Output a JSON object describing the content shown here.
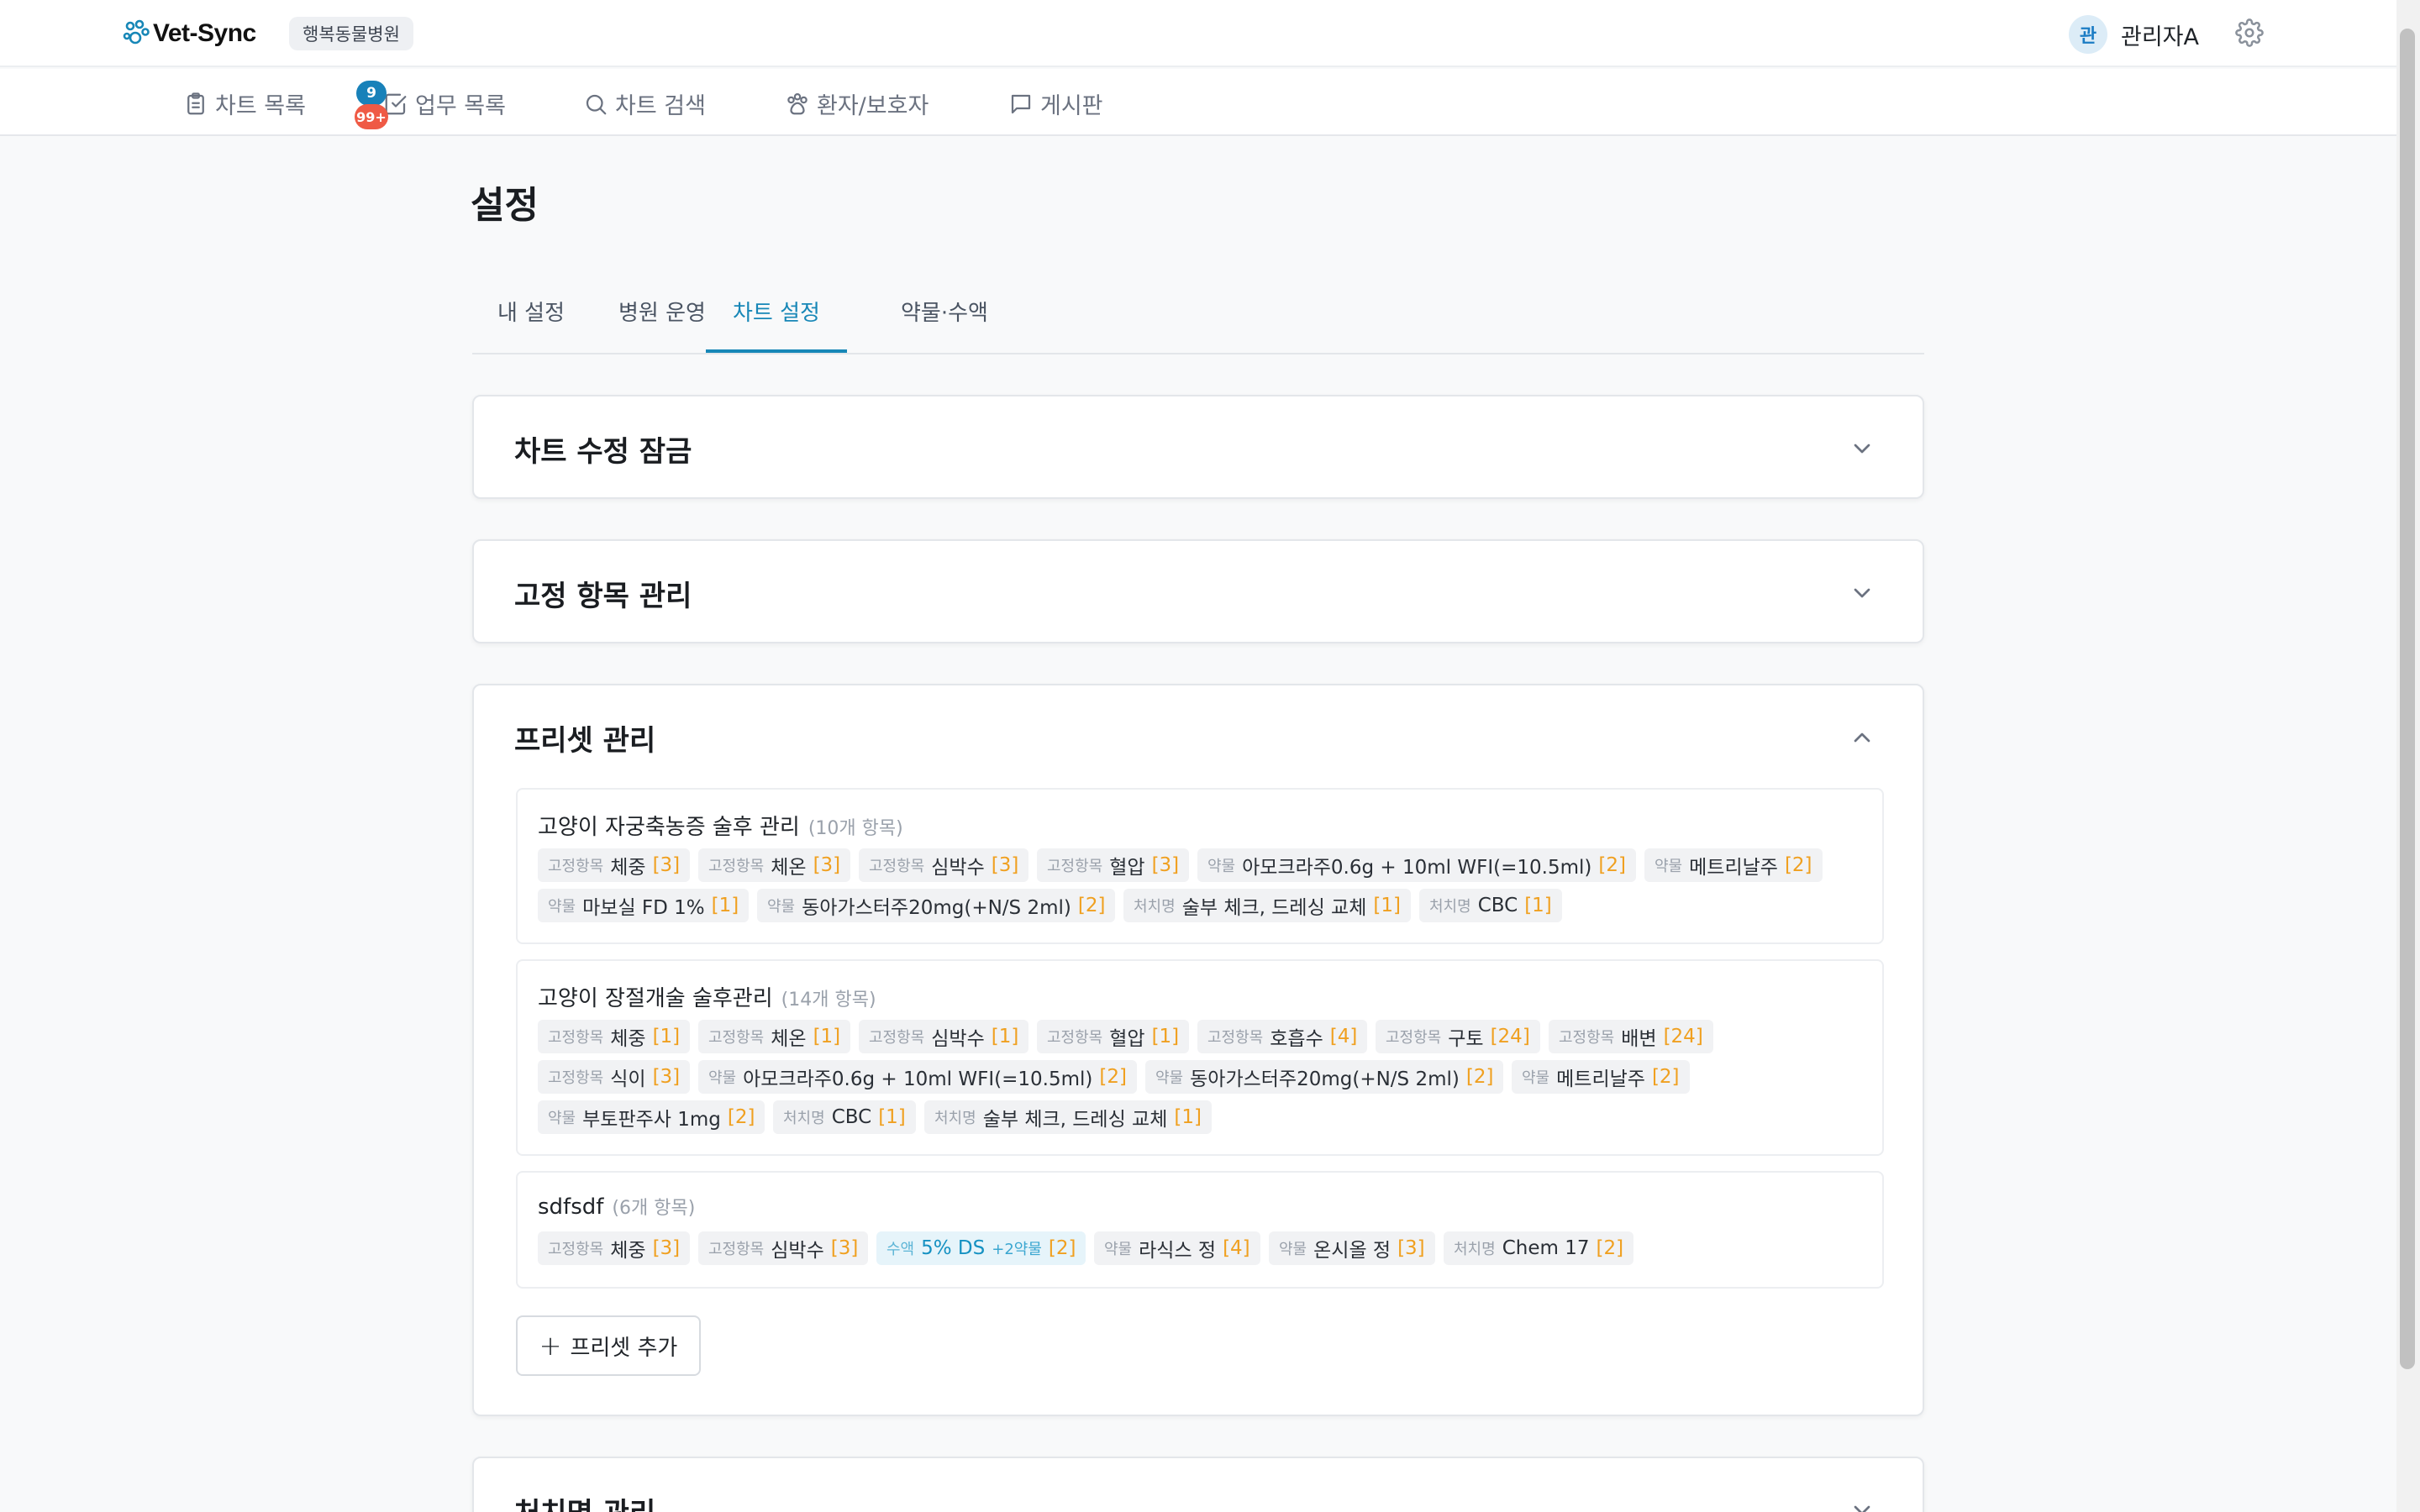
{
  "header": {
    "app_name": "Vet-Sync",
    "hospital": "행복동물병원",
    "avatar_initial": "관",
    "user_name": "관리자A"
  },
  "nav": {
    "items": [
      {
        "label": "차트 목록",
        "icon": "clipboard-icon"
      },
      {
        "label": "업무 목록",
        "icon": "checkbox-icon"
      },
      {
        "label": "차트 검색",
        "icon": "search-icon"
      },
      {
        "label": "환자/보호자",
        "icon": "paw-icon"
      },
      {
        "label": "게시판",
        "icon": "message-icon"
      }
    ],
    "badge_top": "9",
    "badge_bottom": "99+"
  },
  "page": {
    "title": "설정",
    "tabs": [
      "내 설정",
      "병원 운영",
      "차트 설정",
      "약물·수액"
    ],
    "active_tab": "차트 설정"
  },
  "sections": {
    "lock": "차트 수정 잠금",
    "fixed": "고정 항목 관리",
    "preset": "프리셋 관리",
    "treatment": "처치명 관리"
  },
  "presets": [
    {
      "name": "고양이 자궁축농증 술후 관리",
      "count": "(10개 항목)",
      "chips": [
        {
          "type": "고정항목",
          "label": "체중",
          "count": "[3]"
        },
        {
          "type": "고정항목",
          "label": "체온",
          "count": "[3]"
        },
        {
          "type": "고정항목",
          "label": "심박수",
          "count": "[3]"
        },
        {
          "type": "고정항목",
          "label": "혈압",
          "count": "[3]"
        },
        {
          "type": "약물",
          "label": "아모크라주0.6g + 10ml WFI(=10.5ml)",
          "count": "[2]"
        },
        {
          "type": "약물",
          "label": "메트리날주",
          "count": "[2]"
        },
        {
          "type": "약물",
          "label": "마보실 FD 1%",
          "count": "[1]"
        },
        {
          "type": "약물",
          "label": "동아가스터주20mg(+N/S 2ml)",
          "count": "[2]"
        },
        {
          "type": "처치명",
          "label": "술부 체크, 드레싱 교체",
          "count": "[1]"
        },
        {
          "type": "처치명",
          "label": "CBC",
          "count": "[1]"
        }
      ]
    },
    {
      "name": "고양이 장절개술 술후관리",
      "count": "(14개 항목)",
      "chips": [
        {
          "type": "고정항목",
          "label": "체중",
          "count": "[1]"
        },
        {
          "type": "고정항목",
          "label": "체온",
          "count": "[1]"
        },
        {
          "type": "고정항목",
          "label": "심박수",
          "count": "[1]"
        },
        {
          "type": "고정항목",
          "label": "혈압",
          "count": "[1]"
        },
        {
          "type": "고정항목",
          "label": "호흡수",
          "count": "[4]"
        },
        {
          "type": "고정항목",
          "label": "구토",
          "count": "[24]"
        },
        {
          "type": "고정항목",
          "label": "배변",
          "count": "[24]"
        },
        {
          "type": "고정항목",
          "label": "식이",
          "count": "[3]"
        },
        {
          "type": "약물",
          "label": "아모크라주0.6g + 10ml WFI(=10.5ml)",
          "count": "[2]"
        },
        {
          "type": "약물",
          "label": "동아가스터주20mg(+N/S 2ml)",
          "count": "[2]"
        },
        {
          "type": "약물",
          "label": "메트리날주",
          "count": "[2]"
        },
        {
          "type": "약물",
          "label": "부토판주사 1mg",
          "count": "[2]"
        },
        {
          "type": "처치명",
          "label": "CBC",
          "count": "[1]"
        },
        {
          "type": "처치명",
          "label": "술부 체크, 드레싱 교체",
          "count": "[1]"
        }
      ]
    },
    {
      "name": "sdfsdf",
      "count": "(6개 항목)",
      "chips": [
        {
          "type": "고정항목",
          "label": "체중",
          "count": "[3]"
        },
        {
          "type": "고정항목",
          "label": "심박수",
          "count": "[3]"
        },
        {
          "type": "수액",
          "label": "5% DS",
          "extra": "+2약물",
          "count": "[2]"
        },
        {
          "type": "약물",
          "label": "라식스 정",
          "count": "[4]"
        },
        {
          "type": "약물",
          "label": "온시올 정",
          "count": "[3]"
        },
        {
          "type": "처치명",
          "label": "Chem 17",
          "count": "[2]"
        }
      ]
    }
  ],
  "add_preset_label": "프리셋 추가",
  "colors": {
    "accent": "#1787b7",
    "count": "#f0a020",
    "badge_blue": "#1881b9",
    "badge_red": "#ef5a45"
  }
}
